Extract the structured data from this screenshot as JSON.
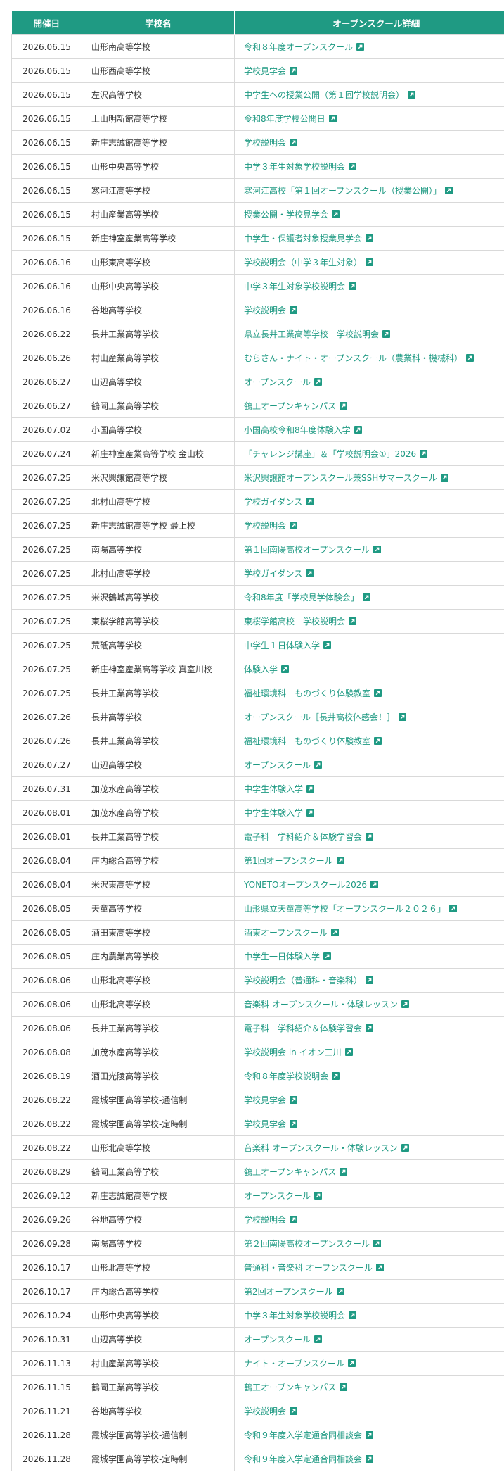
{
  "table": {
    "headers": {
      "date": "開催日",
      "school": "学校名",
      "detail": "オープンスクール詳細"
    },
    "rows": [
      {
        "date": "2026.06.15",
        "school": "山形南高等学校",
        "event": "令和８年度オープンスクール"
      },
      {
        "date": "2026.06.15",
        "school": "山形西高等学校",
        "event": "学校見学会"
      },
      {
        "date": "2026.06.15",
        "school": "左沢高等学校",
        "event": "中学生への授業公開（第１回学校説明会）"
      },
      {
        "date": "2026.06.15",
        "school": "上山明新館高等学校",
        "event": "令和8年度学校公開日"
      },
      {
        "date": "2026.06.15",
        "school": "新庄志誠館高等学校",
        "event": "学校説明会"
      },
      {
        "date": "2026.06.15",
        "school": "山形中央高等学校",
        "event": "中学３年生対象学校説明会"
      },
      {
        "date": "2026.06.15",
        "school": "寒河江高等学校",
        "event": "寒河江高校「第１回オープンスクール（授業公開）」"
      },
      {
        "date": "2026.06.15",
        "school": "村山産業高等学校",
        "event": "授業公開・学校見学会"
      },
      {
        "date": "2026.06.15",
        "school": "新庄神室産業高等学校",
        "event": "中学生・保護者対象授業見学会"
      },
      {
        "date": "2026.06.16",
        "school": "山形東高等学校",
        "event": "学校説明会（中学３年生対象）"
      },
      {
        "date": "2026.06.16",
        "school": "山形中央高等学校",
        "event": "中学３年生対象学校説明会"
      },
      {
        "date": "2026.06.16",
        "school": "谷地高等学校",
        "event": "学校説明会"
      },
      {
        "date": "2026.06.22",
        "school": "長井工業高等学校",
        "event": "県立長井工業高等学校　学校説明会"
      },
      {
        "date": "2026.06.26",
        "school": "村山産業高等学校",
        "event": "むらさん・ナイト・オープンスクール（農業科・機械科）"
      },
      {
        "date": "2026.06.27",
        "school": "山辺高等学校",
        "event": "オープンスクール"
      },
      {
        "date": "2026.06.27",
        "school": "鶴岡工業高等学校",
        "event": "鶴工オープンキャンパス"
      },
      {
        "date": "2026.07.02",
        "school": "小国高等学校",
        "event": "小国高校令和8年度体験入学"
      },
      {
        "date": "2026.07.24",
        "school": "新庄神室産業高等学校 金山校",
        "event": "「チャレンジ講座」＆「学校説明会①」2026"
      },
      {
        "date": "2026.07.25",
        "school": "米沢興譲館高等学校",
        "event": "米沢興譲館オープンスクール兼SSHサマースクール"
      },
      {
        "date": "2026.07.25",
        "school": "北村山高等学校",
        "event": "学校ガイダンス"
      },
      {
        "date": "2026.07.25",
        "school": "新庄志誠館高等学校 最上校",
        "event": "学校説明会"
      },
      {
        "date": "2026.07.25",
        "school": "南陽高等学校",
        "event": "第１回南陽高校オープンスクール"
      },
      {
        "date": "2026.07.25",
        "school": "北村山高等学校",
        "event": "学校ガイダンス"
      },
      {
        "date": "2026.07.25",
        "school": "米沢鶴城高等学校",
        "event": "令和8年度「学校見学体験会」"
      },
      {
        "date": "2026.07.25",
        "school": "東桜学館高等学校",
        "event": "東桜学館高校　学校説明会"
      },
      {
        "date": "2026.07.25",
        "school": "荒砥高等学校",
        "event": "中学生１日体験入学"
      },
      {
        "date": "2026.07.25",
        "school": "新庄神室産業高等学校 真室川校",
        "event": "体験入学"
      },
      {
        "date": "2026.07.25",
        "school": "長井工業高等学校",
        "event": "福祉環境科　ものづくり体験教室"
      },
      {
        "date": "2026.07.26",
        "school": "長井高等学校",
        "event": "オープンスクール［長井高校体感会！］"
      },
      {
        "date": "2026.07.26",
        "school": "長井工業高等学校",
        "event": "福祉環境科　ものづくり体験教室"
      },
      {
        "date": "2026.07.27",
        "school": "山辺高等学校",
        "event": "オープンスクール"
      },
      {
        "date": "2026.07.31",
        "school": "加茂水産高等学校",
        "event": "中学生体験入学"
      },
      {
        "date": "2026.08.01",
        "school": "加茂水産高等学校",
        "event": "中学生体験入学"
      },
      {
        "date": "2026.08.01",
        "school": "長井工業高等学校",
        "event": "電子科　学科紹介＆体験学習会"
      },
      {
        "date": "2026.08.04",
        "school": "庄内総合高等学校",
        "event": "第1回オープンスクール"
      },
      {
        "date": "2026.08.04",
        "school": "米沢東高等学校",
        "event": "YONETOオープンスクール2026"
      },
      {
        "date": "2026.08.05",
        "school": "天童高等学校",
        "event": "山形県立天童高等学校「オープンスクール２０２６」"
      },
      {
        "date": "2026.08.05",
        "school": "酒田東高等学校",
        "event": "酒東オープンスクール"
      },
      {
        "date": "2026.08.05",
        "school": "庄内農業高等学校",
        "event": "中学生一日体験入学"
      },
      {
        "date": "2026.08.06",
        "school": "山形北高等学校",
        "event": "学校説明会（普通科・音楽科）"
      },
      {
        "date": "2026.08.06",
        "school": "山形北高等学校",
        "event": "音楽科 オープンスクール・体験レッスン"
      },
      {
        "date": "2026.08.06",
        "school": "長井工業高等学校",
        "event": "電子科　学科紹介＆体験学習会"
      },
      {
        "date": "2026.08.08",
        "school": "加茂水産高等学校",
        "event": "学校説明会 in イオン三川"
      },
      {
        "date": "2026.08.19",
        "school": "酒田光陵高等学校",
        "event": "令和８年度学校説明会"
      },
      {
        "date": "2026.08.22",
        "school": "霞城学園高等学校-通信制",
        "event": "学校見学会"
      },
      {
        "date": "2026.08.22",
        "school": "霞城学園高等学校-定時制",
        "event": "学校見学会"
      },
      {
        "date": "2026.08.22",
        "school": "山形北高等学校",
        "event": "音楽科 オープンスクール・体験レッスン"
      },
      {
        "date": "2026.08.29",
        "school": "鶴岡工業高等学校",
        "event": "鶴工オープンキャンパス"
      },
      {
        "date": "2026.09.12",
        "school": "新庄志誠館高等学校",
        "event": "オープンスクール"
      },
      {
        "date": "2026.09.26",
        "school": "谷地高等学校",
        "event": "学校説明会"
      },
      {
        "date": "2026.09.28",
        "school": "南陽高等学校",
        "event": "第２回南陽高校オープンスクール"
      },
      {
        "date": "2026.10.17",
        "school": "山形北高等学校",
        "event": "普通科・音楽科 オープンスクール"
      },
      {
        "date": "2026.10.17",
        "school": "庄内総合高等学校",
        "event": "第2回オープンスクール"
      },
      {
        "date": "2026.10.24",
        "school": "山形中央高等学校",
        "event": "中学３年生対象学校説明会"
      },
      {
        "date": "2026.10.31",
        "school": "山辺高等学校",
        "event": "オープンスクール"
      },
      {
        "date": "2026.11.13",
        "school": "村山産業高等学校",
        "event": "ナイト・オープンスクール"
      },
      {
        "date": "2026.11.15",
        "school": "鶴岡工業高等学校",
        "event": "鶴工オープンキャンパス"
      },
      {
        "date": "2026.11.21",
        "school": "谷地高等学校",
        "event": "学校説明会"
      },
      {
        "date": "2026.11.28",
        "school": "霞城学園高等学校-通信制",
        "event": "令和９年度入学定通合同相談会"
      },
      {
        "date": "2026.11.28",
        "school": "霞城学園高等学校-定時制",
        "event": "令和９年度入学定通合同相談会"
      }
    ]
  },
  "icons": {
    "external_link": "external-link-icon"
  },
  "colors": {
    "accent": "#1f9a83",
    "text": "#333333",
    "border": "#d9d9d9"
  }
}
